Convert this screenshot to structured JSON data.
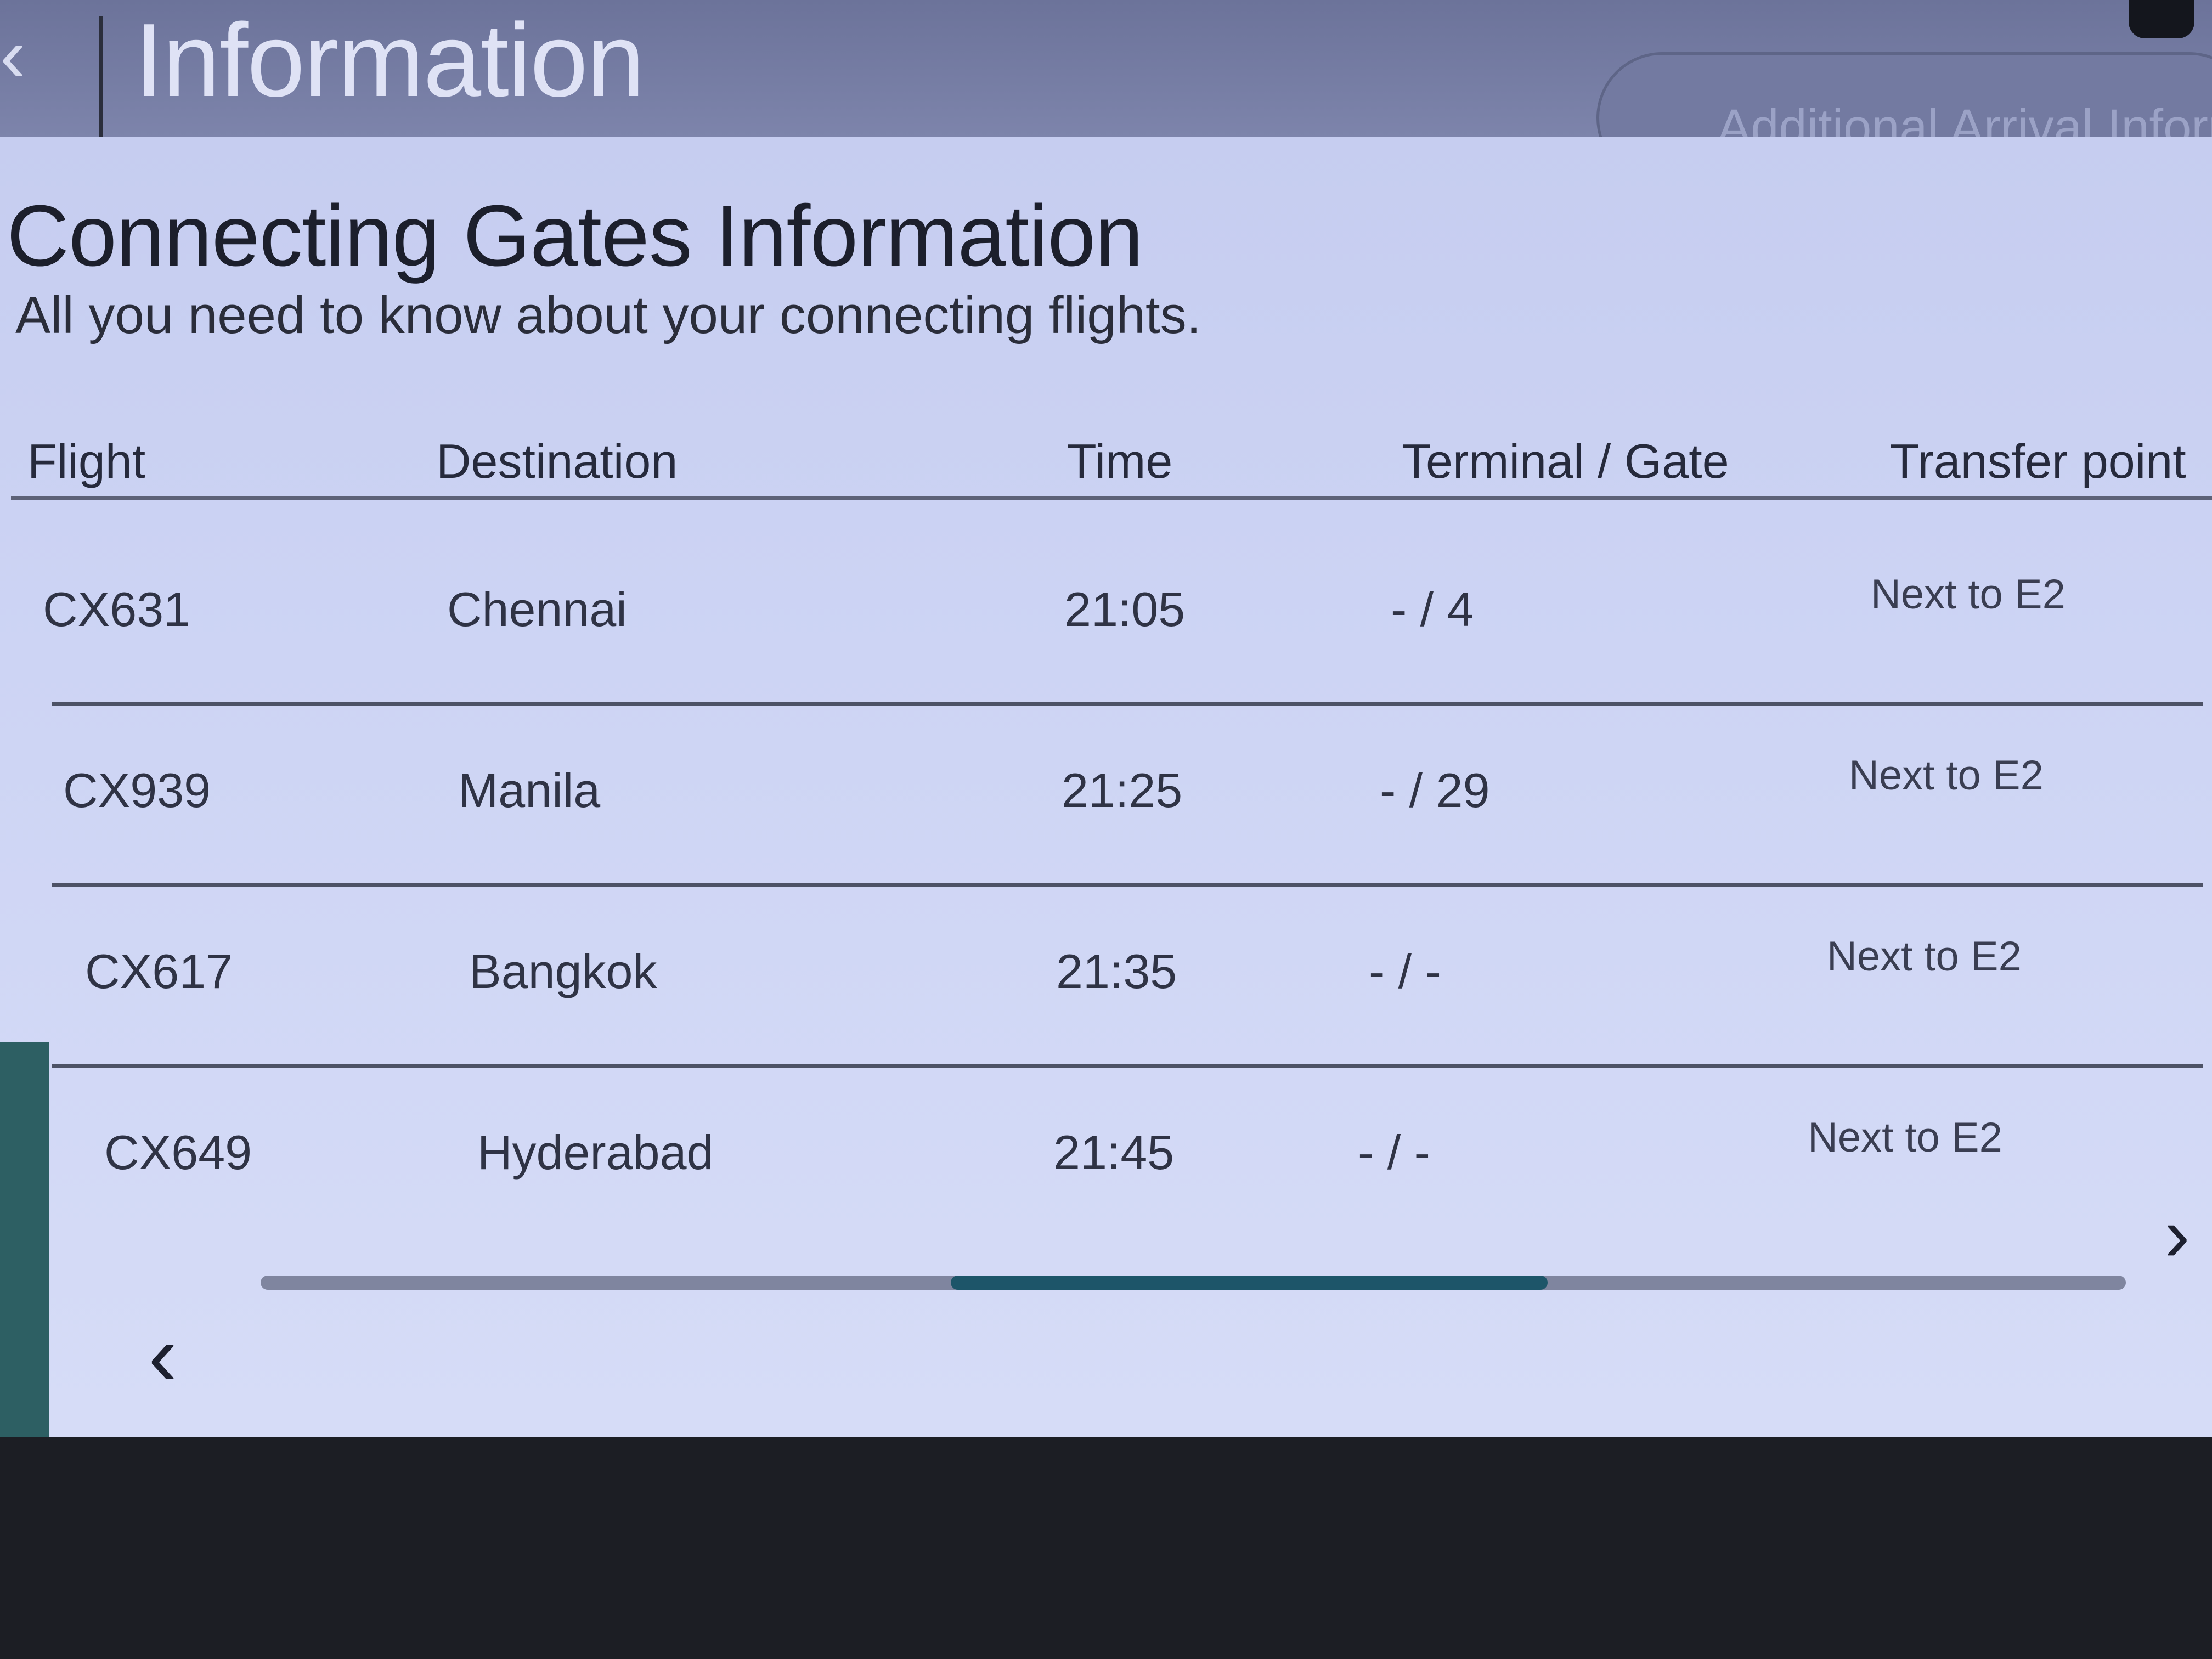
{
  "header": {
    "title": "Information",
    "arrival_button_label": "Additional Arrival Inform"
  },
  "page": {
    "title": "Connecting Gates Information",
    "subtitle": "All you need to know about your connecting flights."
  },
  "table": {
    "columns": [
      "Flight",
      "Destination",
      "Time",
      "Terminal / Gate",
      "Transfer point"
    ],
    "rows": [
      {
        "flight": "CX631",
        "destination": "Chennai",
        "time": "21:05",
        "terminal_gate": "- / 4",
        "transfer_point": "Next to E2"
      },
      {
        "flight": "CX939",
        "destination": "Manila",
        "time": "21:25",
        "terminal_gate": "- / 29",
        "transfer_point": "Next to E2"
      },
      {
        "flight": "CX617",
        "destination": "Bangkok",
        "time": "21:35",
        "terminal_gate": "- / -",
        "transfer_point": "Next to E2"
      },
      {
        "flight": "CX649",
        "destination": "Hyderabad",
        "time": "21:45",
        "terminal_gate": "- / -",
        "transfer_point": "Next to E2"
      }
    ]
  },
  "scroll": {
    "position_fraction": 0.37,
    "visible_fraction": 0.32
  },
  "icons": {
    "back": "chevron-left-icon",
    "scroll_left": "chevron-left-icon",
    "scroll_right": "chevron-right-icon"
  },
  "colors": {
    "header_bg": "#737aa1",
    "panel_bg": "#cdd4f4",
    "scroll_thumb": "#1d5569",
    "text": "#2f3345"
  }
}
